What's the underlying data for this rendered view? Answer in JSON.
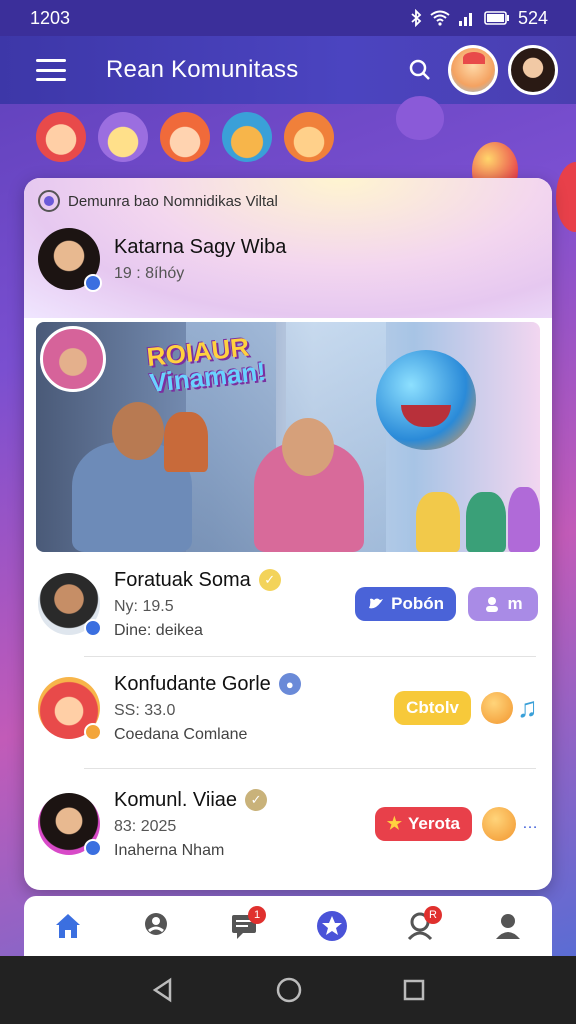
{
  "status_bar": {
    "time": "1203",
    "battery": "524"
  },
  "app_bar": {
    "title": "Rean Komunitass"
  },
  "group": {
    "label": "Demunra bao  Nomnidikas Viltal"
  },
  "post": {
    "author": "Katarna Sagy Wiba",
    "meta": "19 : 8íhóy",
    "headline_1": "ROIAUR",
    "headline_2": "Vinaman!"
  },
  "rows": [
    {
      "name": "Foratuak Soma",
      "sub": "Ny: 19.5",
      "sub2": "Dine: deikea",
      "action1": "Pobón",
      "action2": "m",
      "action1_color": "#4a63d8",
      "action2_color": "#a98be6"
    },
    {
      "name": "Konfudante Gorle",
      "sub": "SS: 33.0",
      "sub2": "Coedana Comlane",
      "action1": "Cbtolv",
      "action1_color": "#f7c93a"
    },
    {
      "name": "Komunl. Viiae",
      "sub": "83: 2025",
      "sub2": "Inaherna Nham",
      "action1": "Yerota",
      "action1_color": "#e8404a"
    }
  ],
  "nav": {
    "messages_badge": "1",
    "profile_badge": "R"
  },
  "colors": {
    "primary": "#3d37a8",
    "accent": "#4a63d8",
    "alert": "#e0302e"
  }
}
